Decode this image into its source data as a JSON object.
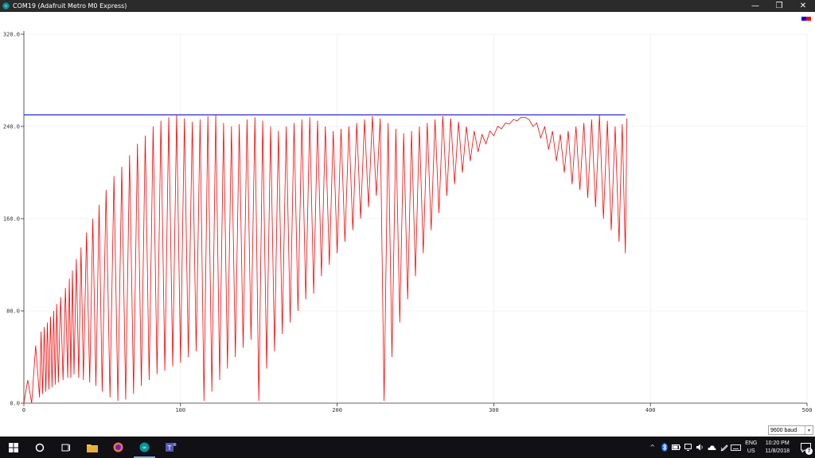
{
  "window": {
    "title": "COM19 (Adafruit Metro M0 Express)",
    "minimize": "—",
    "restore": "❐",
    "close": "✕"
  },
  "chart_data": {
    "type": "line",
    "xlim": [
      0,
      500
    ],
    "ylim": [
      0,
      320
    ],
    "x_ticks": [
      0,
      100,
      200,
      300,
      400,
      500
    ],
    "y_ticks": [
      "0.0",
      "80.0",
      "160.0",
      "240.0",
      "320.0"
    ],
    "grid": true,
    "legend": "top-right",
    "series": [
      {
        "color": "#ff0000",
        "description_points": "sawtooth: quick charge ramps that drop back down; the troughs rise over time while the peaks stay near 250",
        "x": [
          0,
          5,
          10,
          12,
          14,
          16,
          18,
          20,
          22,
          25,
          28,
          30,
          32,
          35,
          38,
          42,
          46,
          50,
          55,
          60,
          65,
          70,
          75,
          80,
          85,
          90,
          95,
          100,
          105,
          110,
          115,
          120,
          125,
          130,
          135,
          140,
          145,
          150,
          155,
          160,
          165,
          170,
          175,
          180,
          185,
          190,
          195,
          200,
          205,
          210,
          215,
          220,
          225,
          230,
          235,
          240,
          245,
          250,
          255,
          260,
          265,
          270,
          275,
          280,
          285,
          290,
          295,
          300,
          305,
          310,
          315,
          320,
          325,
          330,
          335,
          340,
          345,
          350,
          355,
          360,
          365,
          370,
          375,
          380,
          384
        ],
        "peaks": [
          20,
          50,
          62,
          66,
          70,
          75,
          80,
          86,
          92,
          100,
          108,
          115,
          125,
          135,
          148,
          160,
          172,
          185,
          197,
          205,
          215,
          225,
          232,
          240,
          245,
          248,
          250,
          247,
          244,
          246,
          249,
          250,
          243,
          240,
          242,
          246,
          248,
          245,
          240,
          236,
          240,
          243,
          246,
          248,
          245,
          240,
          236,
          238,
          240,
          243,
          246,
          249,
          247,
          243,
          238,
          234,
          236,
          240,
          243,
          246,
          249,
          247,
          244,
          240,
          236,
          233,
          236,
          240,
          243,
          246,
          248,
          246,
          243,
          240,
          236,
          233,
          236,
          240,
          243,
          246,
          250,
          245,
          240,
          242,
          247
        ],
        "troughs": [
          0,
          0,
          5,
          8,
          10,
          12,
          14,
          16,
          18,
          20,
          22,
          22,
          25,
          22,
          20,
          18,
          15,
          10,
          5,
          2,
          3,
          8,
          15,
          20,
          25,
          28,
          32,
          35,
          40,
          45,
          2,
          10,
          20,
          30,
          40,
          48,
          55,
          2,
          30,
          45,
          60,
          70,
          80,
          90,
          95,
          110,
          120,
          130,
          140,
          150,
          160,
          170,
          180,
          2,
          40,
          70,
          90,
          110,
          130,
          150,
          165,
          180,
          190,
          200,
          210,
          218,
          225,
          232,
          238,
          242,
          245,
          248,
          240,
          230,
          220,
          210,
          200,
          190,
          185,
          178,
          170,
          160,
          150,
          140,
          130
        ]
      },
      {
        "color": "#0000ff",
        "x": [
          0,
          384
        ],
        "values": [
          250,
          250
        ]
      }
    ]
  },
  "serial_plotter": {
    "baud_rate": "9600 baud",
    "baud_arrow": "▾"
  },
  "taskbar": {
    "language_top": "ENG",
    "language_bottom": "US",
    "time": "10:20 PM",
    "date": "11/8/2018",
    "notification_count": "7",
    "tray_chevron": "^"
  },
  "colors": {
    "titlebar_bg": "#2b2b2b",
    "taskbar_bg": "#101015",
    "plot_red": "#ff0000",
    "plot_blue": "#0000ff",
    "grid": "#e8e8e8"
  }
}
